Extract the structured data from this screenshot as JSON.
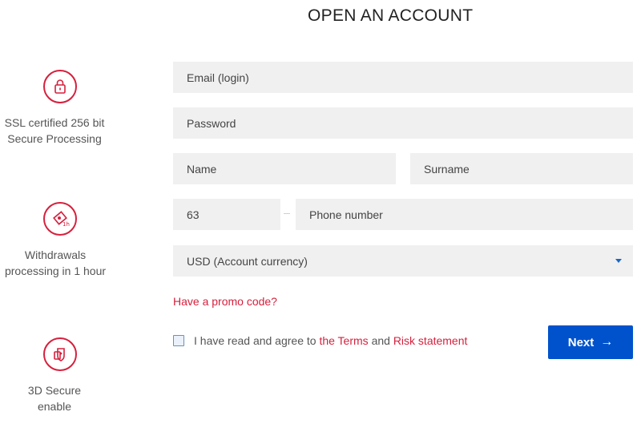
{
  "page": {
    "title": "OPEN AN ACCOUNT"
  },
  "features": [
    {
      "icon": "lock-icon",
      "text_line1": "SSL certified 256 bit",
      "text_line2": "Secure Processing"
    },
    {
      "icon": "withdrawal-icon",
      "text_line1": "Withdrawals",
      "text_line2": "processing in 1 hour"
    },
    {
      "icon": "shield-icon",
      "text_line1": "3D Secure",
      "text_line2": "enable"
    }
  ],
  "form": {
    "email_placeholder": "Email (login)",
    "password_placeholder": "Password",
    "name_placeholder": "Name",
    "surname_placeholder": "Surname",
    "phone_code": "63",
    "phone_placeholder": "Phone number",
    "currency_value": "USD (Account currency)",
    "promo_link": "Have a promo code?",
    "agree_prefix": "I have read and agree to",
    "terms_link": "the Terms",
    "agree_and": "and",
    "risk_link": "Risk statement",
    "next_label": "Next",
    "next_arrow": "→"
  },
  "colors": {
    "accent_red": "#d6203d",
    "primary_blue": "#0052cc",
    "field_bg": "#f0f0f0"
  }
}
